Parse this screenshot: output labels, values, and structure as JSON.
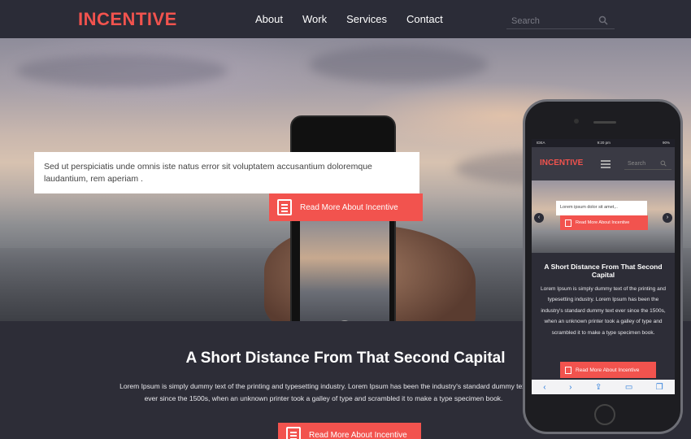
{
  "nav": {
    "logo": "INCENTIVE",
    "items": [
      "About",
      "Work",
      "Services",
      "Contact"
    ],
    "search_placeholder": "Search"
  },
  "hero": {
    "quote": "Sed ut perspiciatis unde omnis iste natus error sit voluptatem accusantium doloremque laudantium, rem aperiam .",
    "button": "Read More About Incentive"
  },
  "section": {
    "heading": "A Short Distance From That Second Capital",
    "body": "Lorem Ipsum is simply dummy text of the printing and typesetting industry. Lorem Ipsum has been the industry's standard dummy text ever since the 1500s, when an unknown printer took a galley of type and scrambled it to make a type specimen book.",
    "button": "Read More About Incentive"
  },
  "mobile": {
    "carrier": "IDEA",
    "time": "9:20 pm",
    "battery": "90%",
    "logo": "INCENTIVE",
    "search_placeholder": "Search",
    "hero_text": "Lorem ipsum dolor sit amet,..",
    "hero_button": "Read More About Incentive",
    "heading": "A Short Distance From That Second Capital",
    "body": "Lorem Ipsum is simply dummy text of the printing and typesetting industry. Lorem Ipsum has been the industry's standard dummy text ever since the 1500s, when an unknown printer took a galley of type and scrambled it to make a type specimen book.",
    "button": "Read More About Incentive"
  },
  "colors": {
    "accent": "#f2534e",
    "nav_bg": "#2b2c37",
    "section_bg": "#2d2d37"
  }
}
